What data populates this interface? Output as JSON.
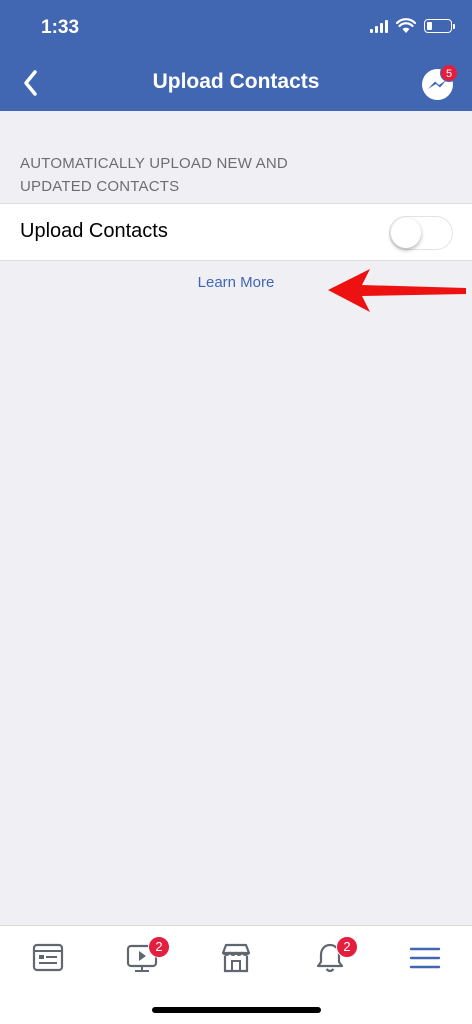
{
  "status_bar": {
    "time": "1:33"
  },
  "nav": {
    "title": "Upload Contacts",
    "messenger_badge": "5"
  },
  "section": {
    "header": "AUTOMATICALLY UPLOAD NEW AND UPDATED CONTACTS"
  },
  "setting": {
    "label": "Upload Contacts",
    "enabled": false
  },
  "learn_more": "Learn More",
  "tabs": [
    {
      "icon": "news-feed-icon",
      "badge": ""
    },
    {
      "icon": "watch-icon",
      "badge": "2"
    },
    {
      "icon": "marketplace-icon",
      "badge": ""
    },
    {
      "icon": "notifications-icon",
      "badge": "2"
    },
    {
      "icon": "menu-icon",
      "badge": "",
      "active": true
    }
  ],
  "colors": {
    "brand": "#4267b2",
    "badge": "#e41e3f",
    "annotation_arrow": "#ee1111"
  }
}
